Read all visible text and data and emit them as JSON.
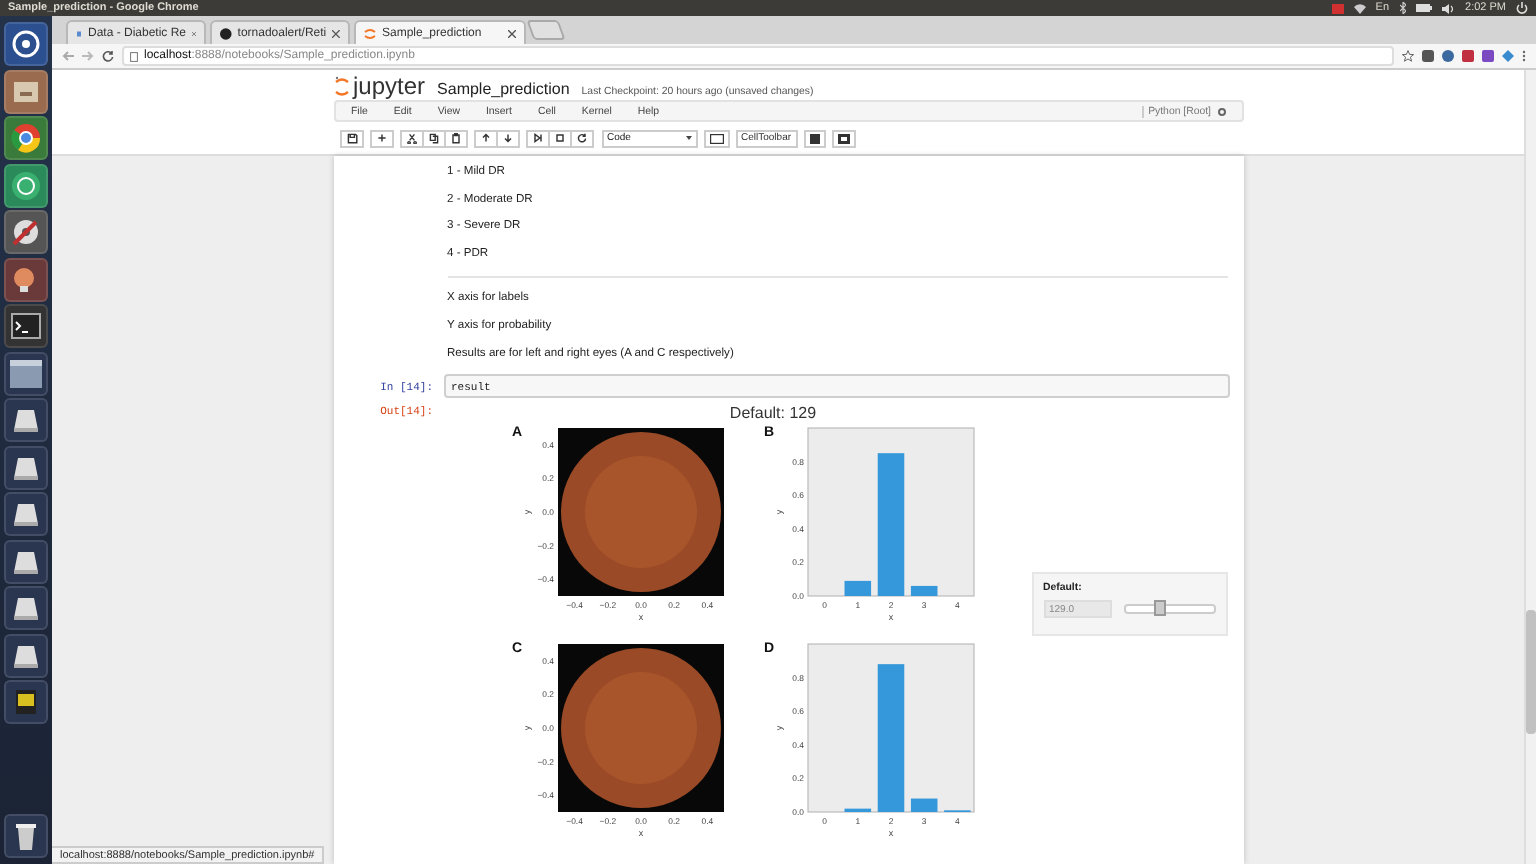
{
  "system_bar": {
    "title": "Sample_prediction - Google Chrome",
    "keyboard": "En",
    "time": "2:02 PM"
  },
  "tabs": [
    {
      "label": "Data - Diabetic Re",
      "selected": false
    },
    {
      "label": "tornadoalert/Reti",
      "selected": false
    },
    {
      "label": "Sample_prediction",
      "selected": true
    }
  ],
  "address_bar": {
    "host": "localhost",
    "path": ":8888/notebooks/Sample_prediction.ipynb"
  },
  "notebook": {
    "logo": "jupyter",
    "name": "Sample_prediction",
    "checkpoint": "Last Checkpoint: 20 hours ago (unsaved changes)",
    "menu": [
      "File",
      "Edit",
      "View",
      "Insert",
      "Cell",
      "Kernel",
      "Help"
    ],
    "kernel": "Python [Root]",
    "kernel_busy": false,
    "cell_type": "Code",
    "cell_toolbar": "CellToolbar"
  },
  "markdown": {
    "classes": [
      "1 - Mild DR",
      "2 - Moderate DR",
      "3 - Severe DR",
      "4 - PDR"
    ],
    "notes": [
      "X axis for labels",
      "Y axis for probability",
      "Results are for left and right eyes (A and C respectively)"
    ]
  },
  "input_cell": {
    "prompt": "In [14]:",
    "code": "result"
  },
  "output": {
    "prompt": "Out[14]:",
    "title": "Default: 129",
    "panels": [
      {
        "kind": "image",
        "label": "A",
        "xlabel": "x",
        "ylabel": "y",
        "xticks": [
          "−0.4",
          "−0.2",
          "0.0",
          "0.2",
          "0.4"
        ],
        "yticks": [
          "0.4",
          "0.2",
          "0.0",
          "−0.2",
          "−0.4"
        ]
      },
      {
        "kind": "bar",
        "label": "B",
        "chart_data": {
          "type": "bar",
          "xlabel": "x",
          "ylabel": "y",
          "categories": [
            "0",
            "1",
            "2",
            "3",
            "4"
          ],
          "values": [
            0,
            0.09,
            0.85,
            0.06,
            0
          ],
          "ylim": [
            0,
            1
          ],
          "yticks": [
            {
              "value": 0,
              "label": "0.0"
            },
            {
              "value": 0.2,
              "label": "0.2"
            },
            {
              "value": 0.4,
              "label": "0.4"
            },
            {
              "value": 0.6,
              "label": "0.6"
            },
            {
              "value": 0.8,
              "label": "0.8"
            }
          ]
        }
      },
      {
        "kind": "image",
        "label": "C",
        "xlabel": "x",
        "ylabel": "y",
        "xticks": [
          "−0.4",
          "−0.2",
          "0.0",
          "0.2",
          "0.4"
        ],
        "yticks": [
          "0.4",
          "0.2",
          "0.0",
          "−0.2",
          "−0.4"
        ]
      },
      {
        "kind": "bar",
        "label": "D",
        "chart_data": {
          "type": "bar",
          "xlabel": "x",
          "ylabel": "y",
          "categories": [
            "0",
            "1",
            "2",
            "3",
            "4"
          ],
          "values": [
            0,
            0.02,
            0.88,
            0.08,
            0.01
          ],
          "ylim": [
            0,
            1
          ],
          "yticks": [
            {
              "value": 0,
              "label": "0.0"
            },
            {
              "value": 0.2,
              "label": "0.2"
            },
            {
              "value": 0.4,
              "label": "0.4"
            },
            {
              "value": 0.6,
              "label": "0.6"
            },
            {
              "value": 0.8,
              "label": "0.8"
            }
          ]
        }
      }
    ],
    "widget": {
      "label": "Default:",
      "value": "129.0",
      "level": 0.4
    }
  },
  "status_bar": {
    "url": "localhost:8888/notebooks/Sample_prediction.ipynb#"
  }
}
